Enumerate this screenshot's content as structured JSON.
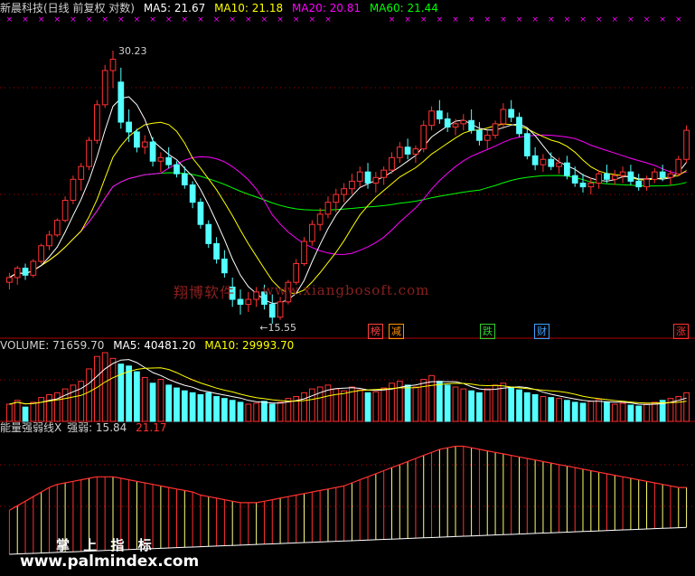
{
  "header": {
    "title": "新晨科技(日线 前复权 对数)",
    "ma5": "MA5: 21.67",
    "ma10": "MA10: 21.18",
    "ma20": "MA20: 20.81",
    "ma60": "MA60: 21.44"
  },
  "volume_header": {
    "label": "VOLUME: 71659.70",
    "ma5": "MA5: 40481.20",
    "ma10": "MA10: 29993.70"
  },
  "indicator_header": {
    "label": "能量强弱线X",
    "value": "强弱: 15.84",
    "extra": "21.17"
  },
  "annotations": {
    "high": "30.23",
    "low": "←15.55"
  },
  "event_tags": [
    {
      "text": "榜",
      "color": "#ff4040"
    },
    {
      "text": "减",
      "color": "#ff9000"
    },
    {
      "text": "跌",
      "color": "#30d030"
    },
    {
      "text": "财",
      "color": "#40a0ff"
    },
    {
      "text": "涨",
      "color": "#ff3030"
    }
  ],
  "watermark": {
    "cn": "翔博软件",
    "url": "www.xiangbosoft.com"
  },
  "branding": {
    "cn": "掌 上 指 标",
    "url": "www.palmindex.com"
  },
  "colors": {
    "up": "#ff3232",
    "down": "#54ffff",
    "ma5": "#ffffff",
    "ma10": "#ffff00",
    "ma20": "#ff00ff",
    "ma60": "#00ff00",
    "grid": "#b00000",
    "cross": "#ff00ff"
  },
  "chart_data": {
    "type": "candlestick",
    "log_scale": true,
    "price_annotations": {
      "max": 30.23,
      "min": 15.55
    },
    "ohlc": [
      [
        17.2,
        17.6,
        16.9,
        17.4
      ],
      [
        17.4,
        17.9,
        17.1,
        17.8
      ],
      [
        17.8,
        18.0,
        17.3,
        17.5
      ],
      [
        17.5,
        18.2,
        17.4,
        18.1
      ],
      [
        18.1,
        18.9,
        18.0,
        18.8
      ],
      [
        18.8,
        19.5,
        18.6,
        19.3
      ],
      [
        19.3,
        20.1,
        19.2,
        20.0
      ],
      [
        20.0,
        21.2,
        19.9,
        21.0
      ],
      [
        21.0,
        22.3,
        20.8,
        22.1
      ],
      [
        22.1,
        23.0,
        21.5,
        22.8
      ],
      [
        22.8,
        24.5,
        22.6,
        24.3
      ],
      [
        24.3,
        26.8,
        24.1,
        26.5
      ],
      [
        26.5,
        29.2,
        26.3,
        28.8
      ],
      [
        28.8,
        30.23,
        27.6,
        29.6
      ],
      [
        28.0,
        29.0,
        25.0,
        25.4
      ],
      [
        25.4,
        26.2,
        24.2,
        24.8
      ],
      [
        24.8,
        25.0,
        23.6,
        23.9
      ],
      [
        23.9,
        24.6,
        23.5,
        24.2
      ],
      [
        24.2,
        24.5,
        22.8,
        23.1
      ],
      [
        23.1,
        23.6,
        22.5,
        23.3
      ],
      [
        23.3,
        23.9,
        22.7,
        22.9
      ],
      [
        22.9,
        23.1,
        22.2,
        22.4
      ],
      [
        22.4,
        22.8,
        21.6,
        21.8
      ],
      [
        21.8,
        22.0,
        20.6,
        20.9
      ],
      [
        20.9,
        21.1,
        19.6,
        19.8
      ],
      [
        19.8,
        20.0,
        18.7,
        18.9
      ],
      [
        18.9,
        19.2,
        18.0,
        18.2
      ],
      [
        18.2,
        18.6,
        17.4,
        17.6
      ],
      [
        17.0,
        17.4,
        16.2,
        16.5
      ],
      [
        16.5,
        16.9,
        15.9,
        16.3
      ],
      [
        16.3,
        16.8,
        16.0,
        16.5
      ],
      [
        16.5,
        17.0,
        16.2,
        16.8
      ],
      [
        16.8,
        17.1,
        16.1,
        16.3
      ],
      [
        16.3,
        16.7,
        15.55,
        15.8
      ],
      [
        15.8,
        16.6,
        15.7,
        16.4
      ],
      [
        16.4,
        17.3,
        16.3,
        17.2
      ],
      [
        17.2,
        18.2,
        17.1,
        18.0
      ],
      [
        18.0,
        19.2,
        17.9,
        19.0
      ],
      [
        19.0,
        20.0,
        18.8,
        19.8
      ],
      [
        19.8,
        20.6,
        19.5,
        20.3
      ],
      [
        20.3,
        21.2,
        20.1,
        20.9
      ],
      [
        20.9,
        21.6,
        20.4,
        21.3
      ],
      [
        21.3,
        21.9,
        20.9,
        21.6
      ],
      [
        21.6,
        22.4,
        21.3,
        22.0
      ],
      [
        22.0,
        22.8,
        21.7,
        22.5
      ],
      [
        22.5,
        23.0,
        21.6,
        21.9
      ],
      [
        21.9,
        22.5,
        21.4,
        22.2
      ],
      [
        22.2,
        22.8,
        21.8,
        22.6
      ],
      [
        22.6,
        23.6,
        22.4,
        23.3
      ],
      [
        23.3,
        24.2,
        23.0,
        23.9
      ],
      [
        23.9,
        24.4,
        23.2,
        23.5
      ],
      [
        23.5,
        24.0,
        23.0,
        23.8
      ],
      [
        23.8,
        25.5,
        23.6,
        25.2
      ],
      [
        25.2,
        26.4,
        24.9,
        26.1
      ],
      [
        26.1,
        26.8,
        25.3,
        25.6
      ],
      [
        25.6,
        26.0,
        24.8,
        25.1
      ],
      [
        25.1,
        25.6,
        24.6,
        25.3
      ],
      [
        25.3,
        25.9,
        24.9,
        25.5
      ],
      [
        25.5,
        26.2,
        24.7,
        24.9
      ],
      [
        24.9,
        25.4,
        24.0,
        24.3
      ],
      [
        24.3,
        24.9,
        23.8,
        24.6
      ],
      [
        24.6,
        25.5,
        24.4,
        25.3
      ],
      [
        25.3,
        26.6,
        25.1,
        26.2
      ],
      [
        26.2,
        26.8,
        25.4,
        25.7
      ],
      [
        25.7,
        26.0,
        24.5,
        24.7
      ],
      [
        24.7,
        25.0,
        23.2,
        23.4
      ],
      [
        23.4,
        23.9,
        22.6,
        22.9
      ],
      [
        22.9,
        23.5,
        22.5,
        23.2
      ],
      [
        23.2,
        23.6,
        22.6,
        22.8
      ],
      [
        22.8,
        23.3,
        22.4,
        23.0
      ],
      [
        23.0,
        23.4,
        22.1,
        22.3
      ],
      [
        22.3,
        22.8,
        21.7,
        21.9
      ],
      [
        21.9,
        22.4,
        21.4,
        21.7
      ],
      [
        21.7,
        22.2,
        21.3,
        21.9
      ],
      [
        21.9,
        22.6,
        21.6,
        22.4
      ],
      [
        22.4,
        22.9,
        21.9,
        22.1
      ],
      [
        22.1,
        22.6,
        21.8,
        22.3
      ],
      [
        22.3,
        22.8,
        21.9,
        22.5
      ],
      [
        22.5,
        22.9,
        21.8,
        22.0
      ],
      [
        22.0,
        22.4,
        21.5,
        21.7
      ],
      [
        21.7,
        22.3,
        21.5,
        22.1
      ],
      [
        22.1,
        22.7,
        21.9,
        22.5
      ],
      [
        22.5,
        22.9,
        22.0,
        22.2
      ],
      [
        22.2,
        22.6,
        21.8,
        22.4
      ],
      [
        22.4,
        23.4,
        22.3,
        23.2
      ],
      [
        23.2,
        25.2,
        23.0,
        24.9
      ]
    ],
    "volume": [
      18,
      22,
      15,
      20,
      25,
      28,
      30,
      34,
      38,
      42,
      55,
      68,
      72,
      66,
      60,
      58,
      52,
      46,
      40,
      44,
      38,
      35,
      32,
      30,
      28,
      30,
      26,
      24,
      22,
      20,
      18,
      19,
      21,
      18,
      20,
      24,
      26,
      30,
      34,
      36,
      38,
      34,
      32,
      36,
      33,
      30,
      31,
      35,
      40,
      42,
      38,
      36,
      44,
      48,
      42,
      38,
      36,
      34,
      32,
      30,
      34,
      38,
      40,
      36,
      33,
      30,
      28,
      26,
      25,
      24,
      22,
      20,
      19,
      21,
      23,
      20,
      18,
      19,
      17,
      16,
      18,
      20,
      22,
      24,
      26,
      30
    ],
    "strength": [
      30,
      33,
      36,
      39,
      42,
      45,
      47,
      48,
      49,
      50,
      51,
      52,
      52,
      52,
      51,
      50,
      49,
      48,
      47,
      46,
      45,
      44,
      43,
      42,
      40,
      39,
      38,
      37,
      36,
      35,
      35,
      35,
      36,
      37,
      38,
      39,
      40,
      41,
      42,
      43,
      44,
      45,
      46,
      48,
      50,
      52,
      54,
      56,
      58,
      60,
      62,
      64,
      66,
      68,
      70,
      71,
      72,
      72,
      71,
      70,
      69,
      68,
      67,
      66,
      65,
      64,
      63,
      62,
      61,
      60,
      59,
      58,
      57,
      56,
      55,
      54,
      53,
      52,
      51,
      50,
      49,
      48,
      47,
      46,
      45,
      45
    ]
  }
}
